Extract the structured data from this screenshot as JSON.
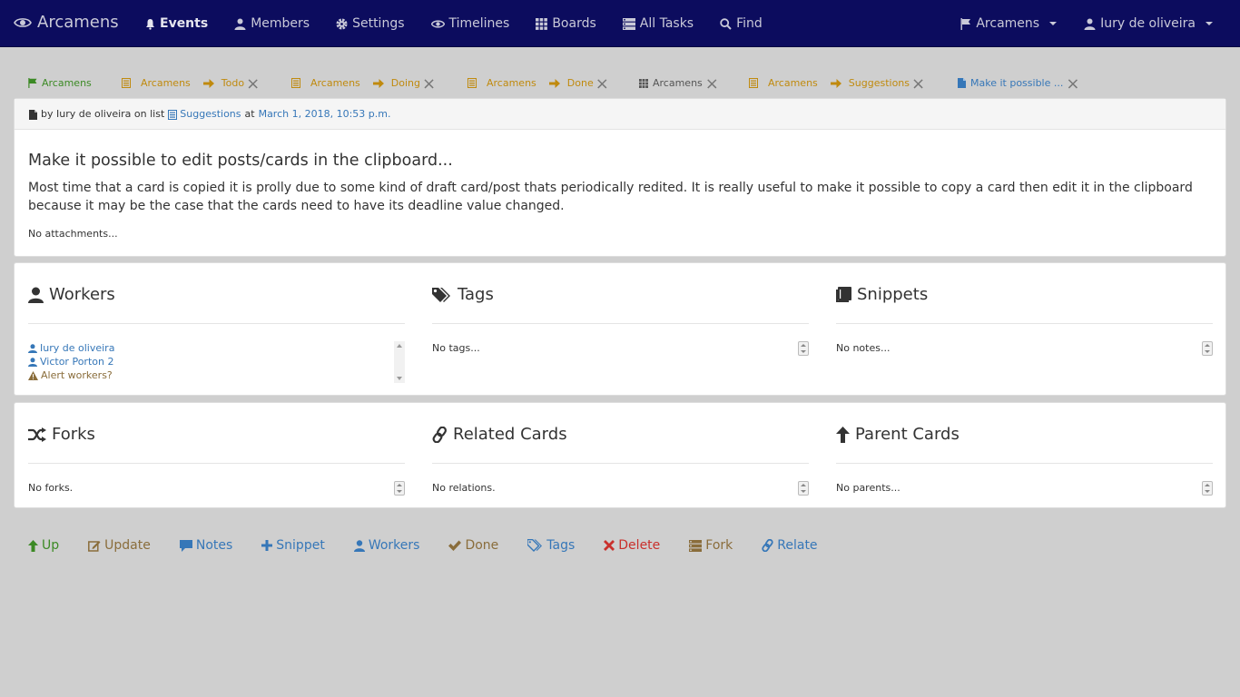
{
  "navbar": {
    "brand": "Arcamens",
    "items": [
      {
        "label": "Events",
        "icon": "bell-icon",
        "active": true
      },
      {
        "label": "Members",
        "icon": "user-icon"
      },
      {
        "label": "Settings",
        "icon": "gear-icon"
      },
      {
        "label": "Timelines",
        "icon": "eye-icon"
      },
      {
        "label": "Boards",
        "icon": "grid-icon"
      },
      {
        "label": "All Tasks",
        "icon": "tasks-icon"
      },
      {
        "label": "Find",
        "icon": "search-icon"
      }
    ],
    "org_menu": "Arcamens",
    "user_menu": "Iury de oliveira"
  },
  "tabs": [
    {
      "kind": "org",
      "label": "Arcamens"
    },
    {
      "kind": "list",
      "board": "Arcamens",
      "list": "Todo"
    },
    {
      "kind": "list",
      "board": "Arcamens",
      "list": "Doing"
    },
    {
      "kind": "list",
      "board": "Arcamens",
      "list": "Done"
    },
    {
      "kind": "board",
      "label": "Arcamens"
    },
    {
      "kind": "list",
      "board": "Arcamens",
      "list": "Suggestions"
    },
    {
      "kind": "card",
      "label": "Make it possible ..."
    }
  ],
  "post": {
    "meta_by": "by Iury de oliveira on list",
    "meta_list": "Suggestions",
    "meta_at": "at",
    "meta_date": "March 1, 2018, 10:53 p.m.",
    "title": "Make it possible to edit posts/cards in the clipboard...",
    "body": "Most time that a card is copied it is prolly due to some kind of draft card/post thats periodically redited. It is really useful to make it possible to copy a card then edit it in the clipboard because it may be the case that the cards need to have its deadline value changed.",
    "attachments": "No attachments..."
  },
  "sections": {
    "workers": {
      "title": "Workers",
      "items": [
        "Iury de oliveira",
        "Victor Porton 2"
      ],
      "alert": "Alert workers?"
    },
    "tags": {
      "title": "Tags",
      "empty": "No tags..."
    },
    "snippets": {
      "title": "Snippets",
      "empty": "No notes..."
    },
    "forks": {
      "title": "Forks",
      "empty": "No forks."
    },
    "related": {
      "title": "Related Cards",
      "empty": "No relations."
    },
    "parents": {
      "title": "Parent Cards",
      "empty": "No parents..."
    }
  },
  "actions": {
    "up": "Up",
    "update": "Update",
    "notes": "Notes",
    "snippet": "Snippet",
    "workers": "Workers",
    "done": "Done",
    "tags": "Tags",
    "delete": "Delete",
    "fork": "Fork",
    "relate": "Relate"
  },
  "colors": {
    "navbar": "#0c0c5e",
    "link": "#3677b8",
    "green": "#3c8a25",
    "orange": "#c08a0e",
    "brown": "#8a6d3b",
    "red": "#c9302c",
    "background": "#cfcfcf"
  }
}
